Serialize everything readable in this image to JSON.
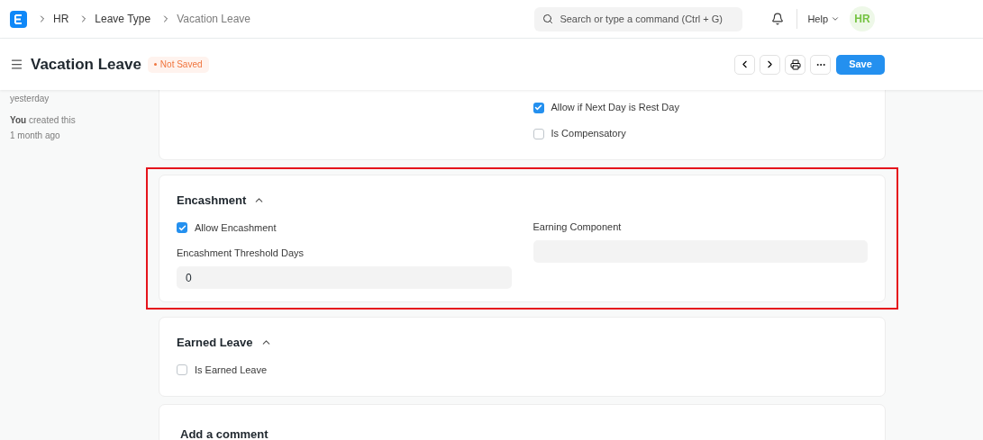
{
  "breadcrumbs": [
    "HR",
    "Leave Type",
    "Vacation Leave"
  ],
  "search": {
    "placeholder": "Search or type a command (Ctrl + G)"
  },
  "help": "Help",
  "avatar": "HR",
  "title": "Vacation Leave",
  "status": "Not Saved",
  "save": "Save",
  "timeline": [
    {
      "text": "yesterday"
    },
    {
      "text": "**You** created this",
      "time": "1 month ago"
    }
  ],
  "sections": [
    {
      "highlighted": false,
      "right": [
        {
          "kind": "checkbox",
          "label": "Allow if Next Day is Rest Day",
          "checked": true
        },
        {
          "kind": "checkbox",
          "label": "Is Compensatory",
          "checked": false
        }
      ]
    },
    {
      "title": "Encashment",
      "highlighted": true,
      "left": [
        {
          "kind": "checkbox",
          "label": "Allow Encashment",
          "checked": true
        },
        {
          "kind": "input",
          "label": "Encashment Threshold Days",
          "value": "0"
        }
      ],
      "right": [
        {
          "kind": "input",
          "label": "Earning Component"
        }
      ]
    },
    {
      "title": "Earned Leave",
      "highlighted": false,
      "left": [
        {
          "kind": "checkbox",
          "label": "Is Earned Leave",
          "checked": false
        }
      ]
    }
  ],
  "comment": {
    "title": "Add a comment"
  }
}
